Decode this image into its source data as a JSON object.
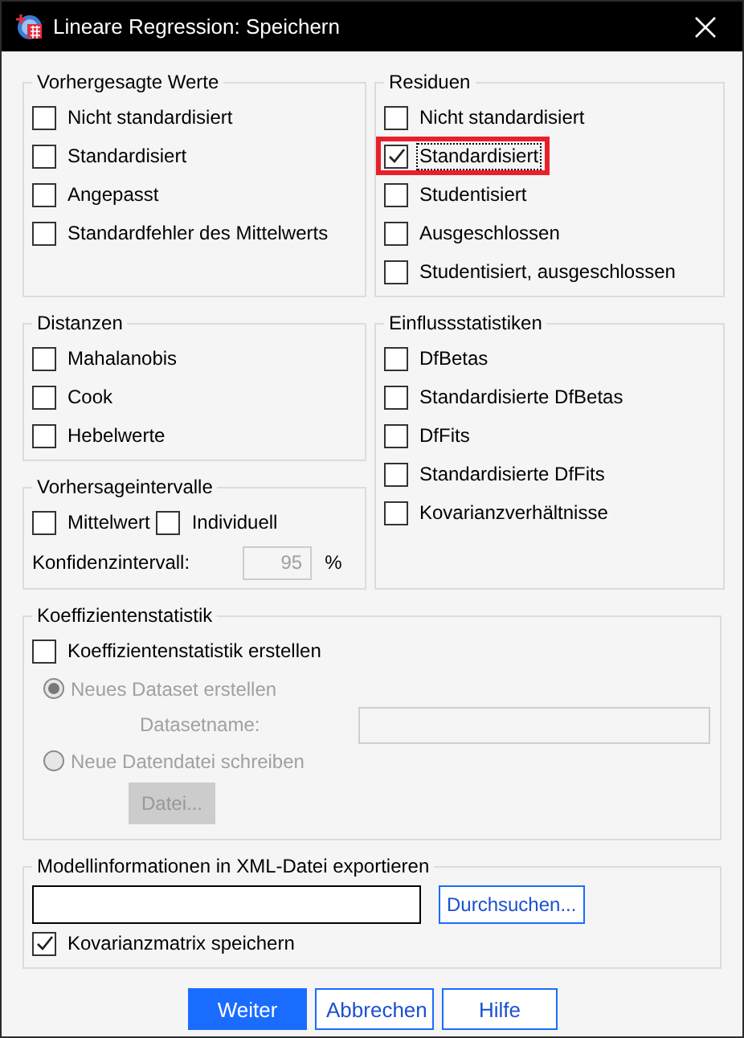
{
  "window": {
    "title": "Lineare Regression: Speichern"
  },
  "predicted": {
    "title": "Vorhergesagte Werte",
    "items": [
      {
        "label": "Nicht standardisiert",
        "checked": false
      },
      {
        "label": "Standardisiert",
        "checked": false
      },
      {
        "label": "Angepasst",
        "checked": false
      },
      {
        "label": "Standardfehler des Mittelwerts",
        "checked": false
      }
    ]
  },
  "residuals": {
    "title": "Residuen",
    "items": [
      {
        "label": "Nicht standardisiert",
        "checked": false,
        "focused": false,
        "highlighted": false
      },
      {
        "label": "Standardisiert",
        "checked": true,
        "focused": true,
        "highlighted": true
      },
      {
        "label": "Studentisiert",
        "checked": false,
        "focused": false,
        "highlighted": false
      },
      {
        "label": "Ausgeschlossen",
        "checked": false,
        "focused": false,
        "highlighted": false
      },
      {
        "label": "Studentisiert, ausgeschlossen",
        "checked": false,
        "focused": false,
        "highlighted": false
      }
    ]
  },
  "distances": {
    "title": "Distanzen",
    "items": [
      {
        "label": "Mahalanobis",
        "checked": false
      },
      {
        "label": "Cook",
        "checked": false
      },
      {
        "label": "Hebelwerte",
        "checked": false
      }
    ]
  },
  "influence": {
    "title": "Einflussstatistiken",
    "items": [
      {
        "label": "DfBetas",
        "checked": false
      },
      {
        "label": "Standardisierte DfBetas",
        "checked": false
      },
      {
        "label": "DfFits",
        "checked": false
      },
      {
        "label": "Standardisierte DfFits",
        "checked": false
      },
      {
        "label": "Kovarianzverhältnisse",
        "checked": false
      }
    ]
  },
  "prediction_intervals": {
    "title": "Vorhersageintervalle",
    "items": [
      {
        "label": "Mittelwert",
        "checked": false
      },
      {
        "label": "Individuell",
        "checked": false
      }
    ],
    "confidence": {
      "label": "Konfidenzintervall:",
      "value": "95",
      "disabled": true
    },
    "unit": "%"
  },
  "coefficients": {
    "title": "Koeffizientenstatistik",
    "create": {
      "label": "Koeffizientenstatistik erstellen",
      "checked": false
    },
    "options": [
      {
        "label": "Neues Dataset erstellen",
        "selected": true,
        "disabled": true
      },
      {
        "label": "Neue Datendatei schreiben",
        "selected": false,
        "disabled": true
      }
    ],
    "dataset_name": {
      "label": "Datasetname:",
      "disabled": true
    },
    "file_button": {
      "label": "Datei...",
      "disabled": true
    }
  },
  "export": {
    "title": "Modellinformationen in XML-Datei exportieren",
    "browse_button": {
      "label": "Durchsuchen..."
    },
    "covariance": {
      "label": "Kovarianzmatrix speichern",
      "checked": true
    }
  },
  "buttons": [
    {
      "label": "Weiter",
      "default": true
    },
    {
      "label": "Abbrechen",
      "default": false
    },
    {
      "label": "Hilfe",
      "default": false
    }
  ]
}
